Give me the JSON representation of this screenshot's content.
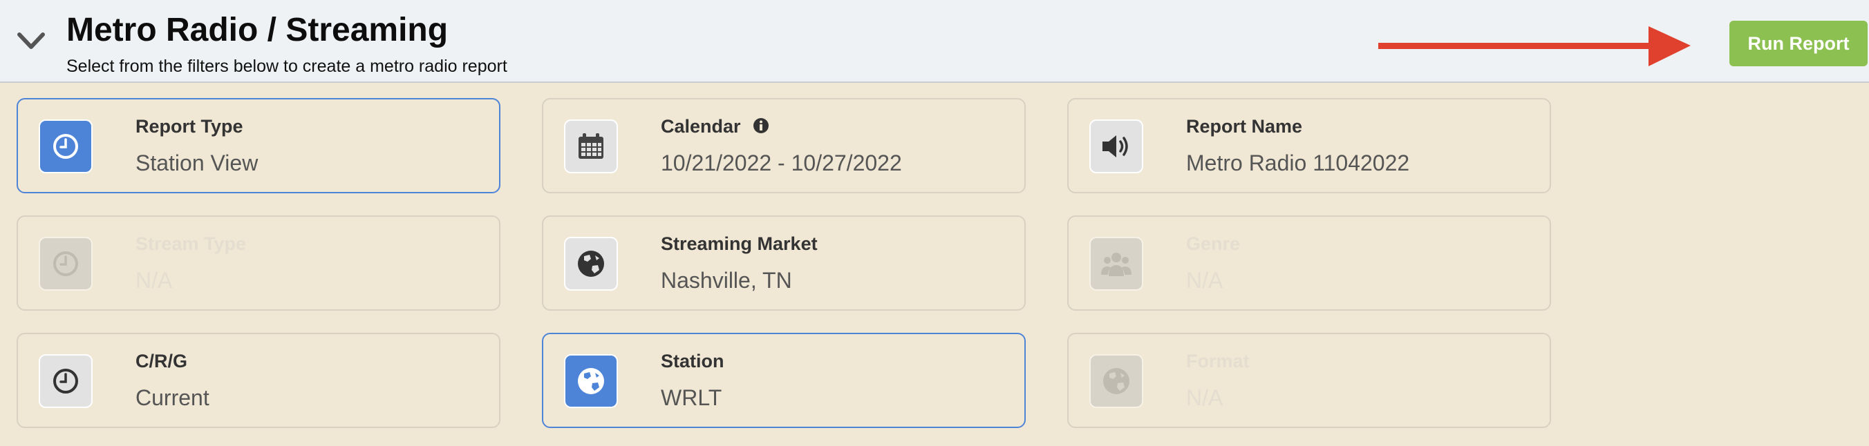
{
  "header": {
    "title": "Metro Radio / Streaming",
    "subtitle": "Select from the filters below to create a metro radio report",
    "run_button": "Run Report"
  },
  "colors": {
    "accent_blue": "#4d84d8",
    "run_green": "#8cc152",
    "arrow_red": "#e0412f",
    "background": "#f0e7d4"
  },
  "filters": [
    {
      "label": "Report Type",
      "value": "Station View",
      "icon": "clock-icon",
      "state": "selected"
    },
    {
      "label": "Calendar",
      "value": "10/21/2022 - 10/27/2022",
      "icon": "calendar-icon",
      "state": "normal",
      "has_info": true
    },
    {
      "label": "Report Name",
      "value": "Metro Radio 11042022",
      "icon": "speaker-icon",
      "state": "normal"
    },
    {
      "label": "Stream Type",
      "value": "N/A",
      "icon": "clock-icon",
      "state": "disabled"
    },
    {
      "label": "Streaming Market",
      "value": "Nashville, TN",
      "icon": "globe-icon",
      "state": "normal"
    },
    {
      "label": "Genre",
      "value": "N/A",
      "icon": "users-icon",
      "state": "disabled"
    },
    {
      "label": "C/R/G",
      "value": "Current",
      "icon": "clock-icon",
      "state": "normal"
    },
    {
      "label": "Station",
      "value": "WRLT",
      "icon": "globe-icon",
      "state": "selected"
    },
    {
      "label": "Format",
      "value": "N/A",
      "icon": "globe-icon",
      "state": "disabled"
    }
  ]
}
